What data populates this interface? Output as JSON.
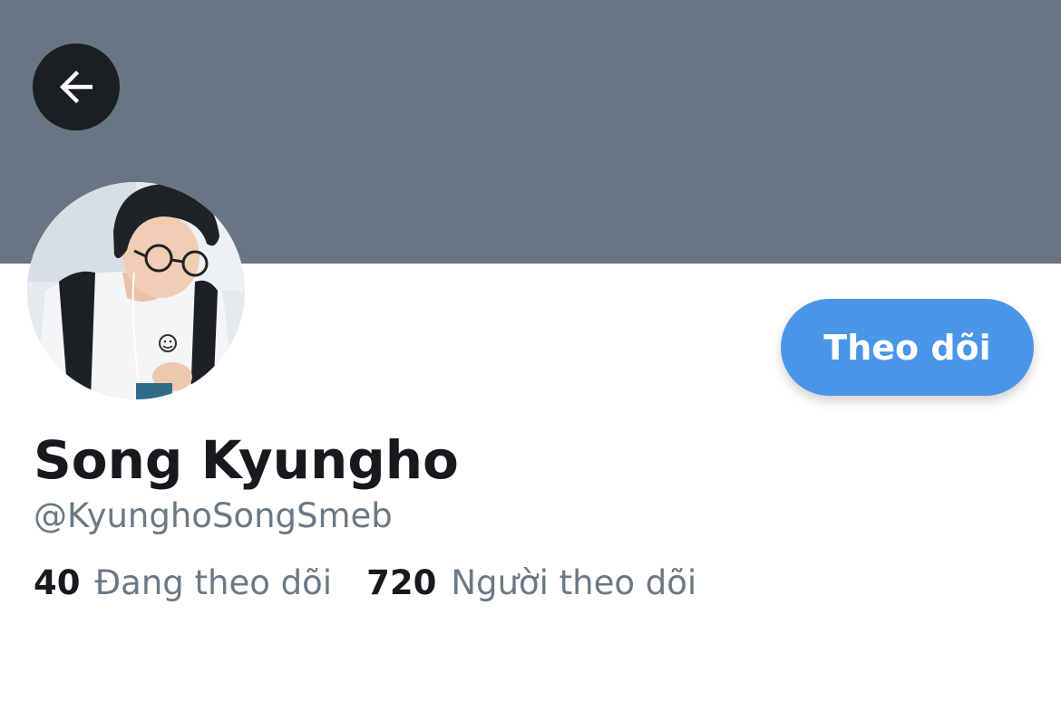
{
  "header": {
    "banner_color": "#687684",
    "back_icon": "arrow-left-icon"
  },
  "profile": {
    "display_name": "Song Kyungho",
    "handle": "@KyunghoSongSmeb",
    "follow_button_label": "Theo dõi",
    "follow_button_color": "#4a95e8"
  },
  "stats": {
    "following_count": "40",
    "following_label": "Đang theo dõi",
    "followers_count": "720",
    "followers_label": "Người theo dõi"
  }
}
